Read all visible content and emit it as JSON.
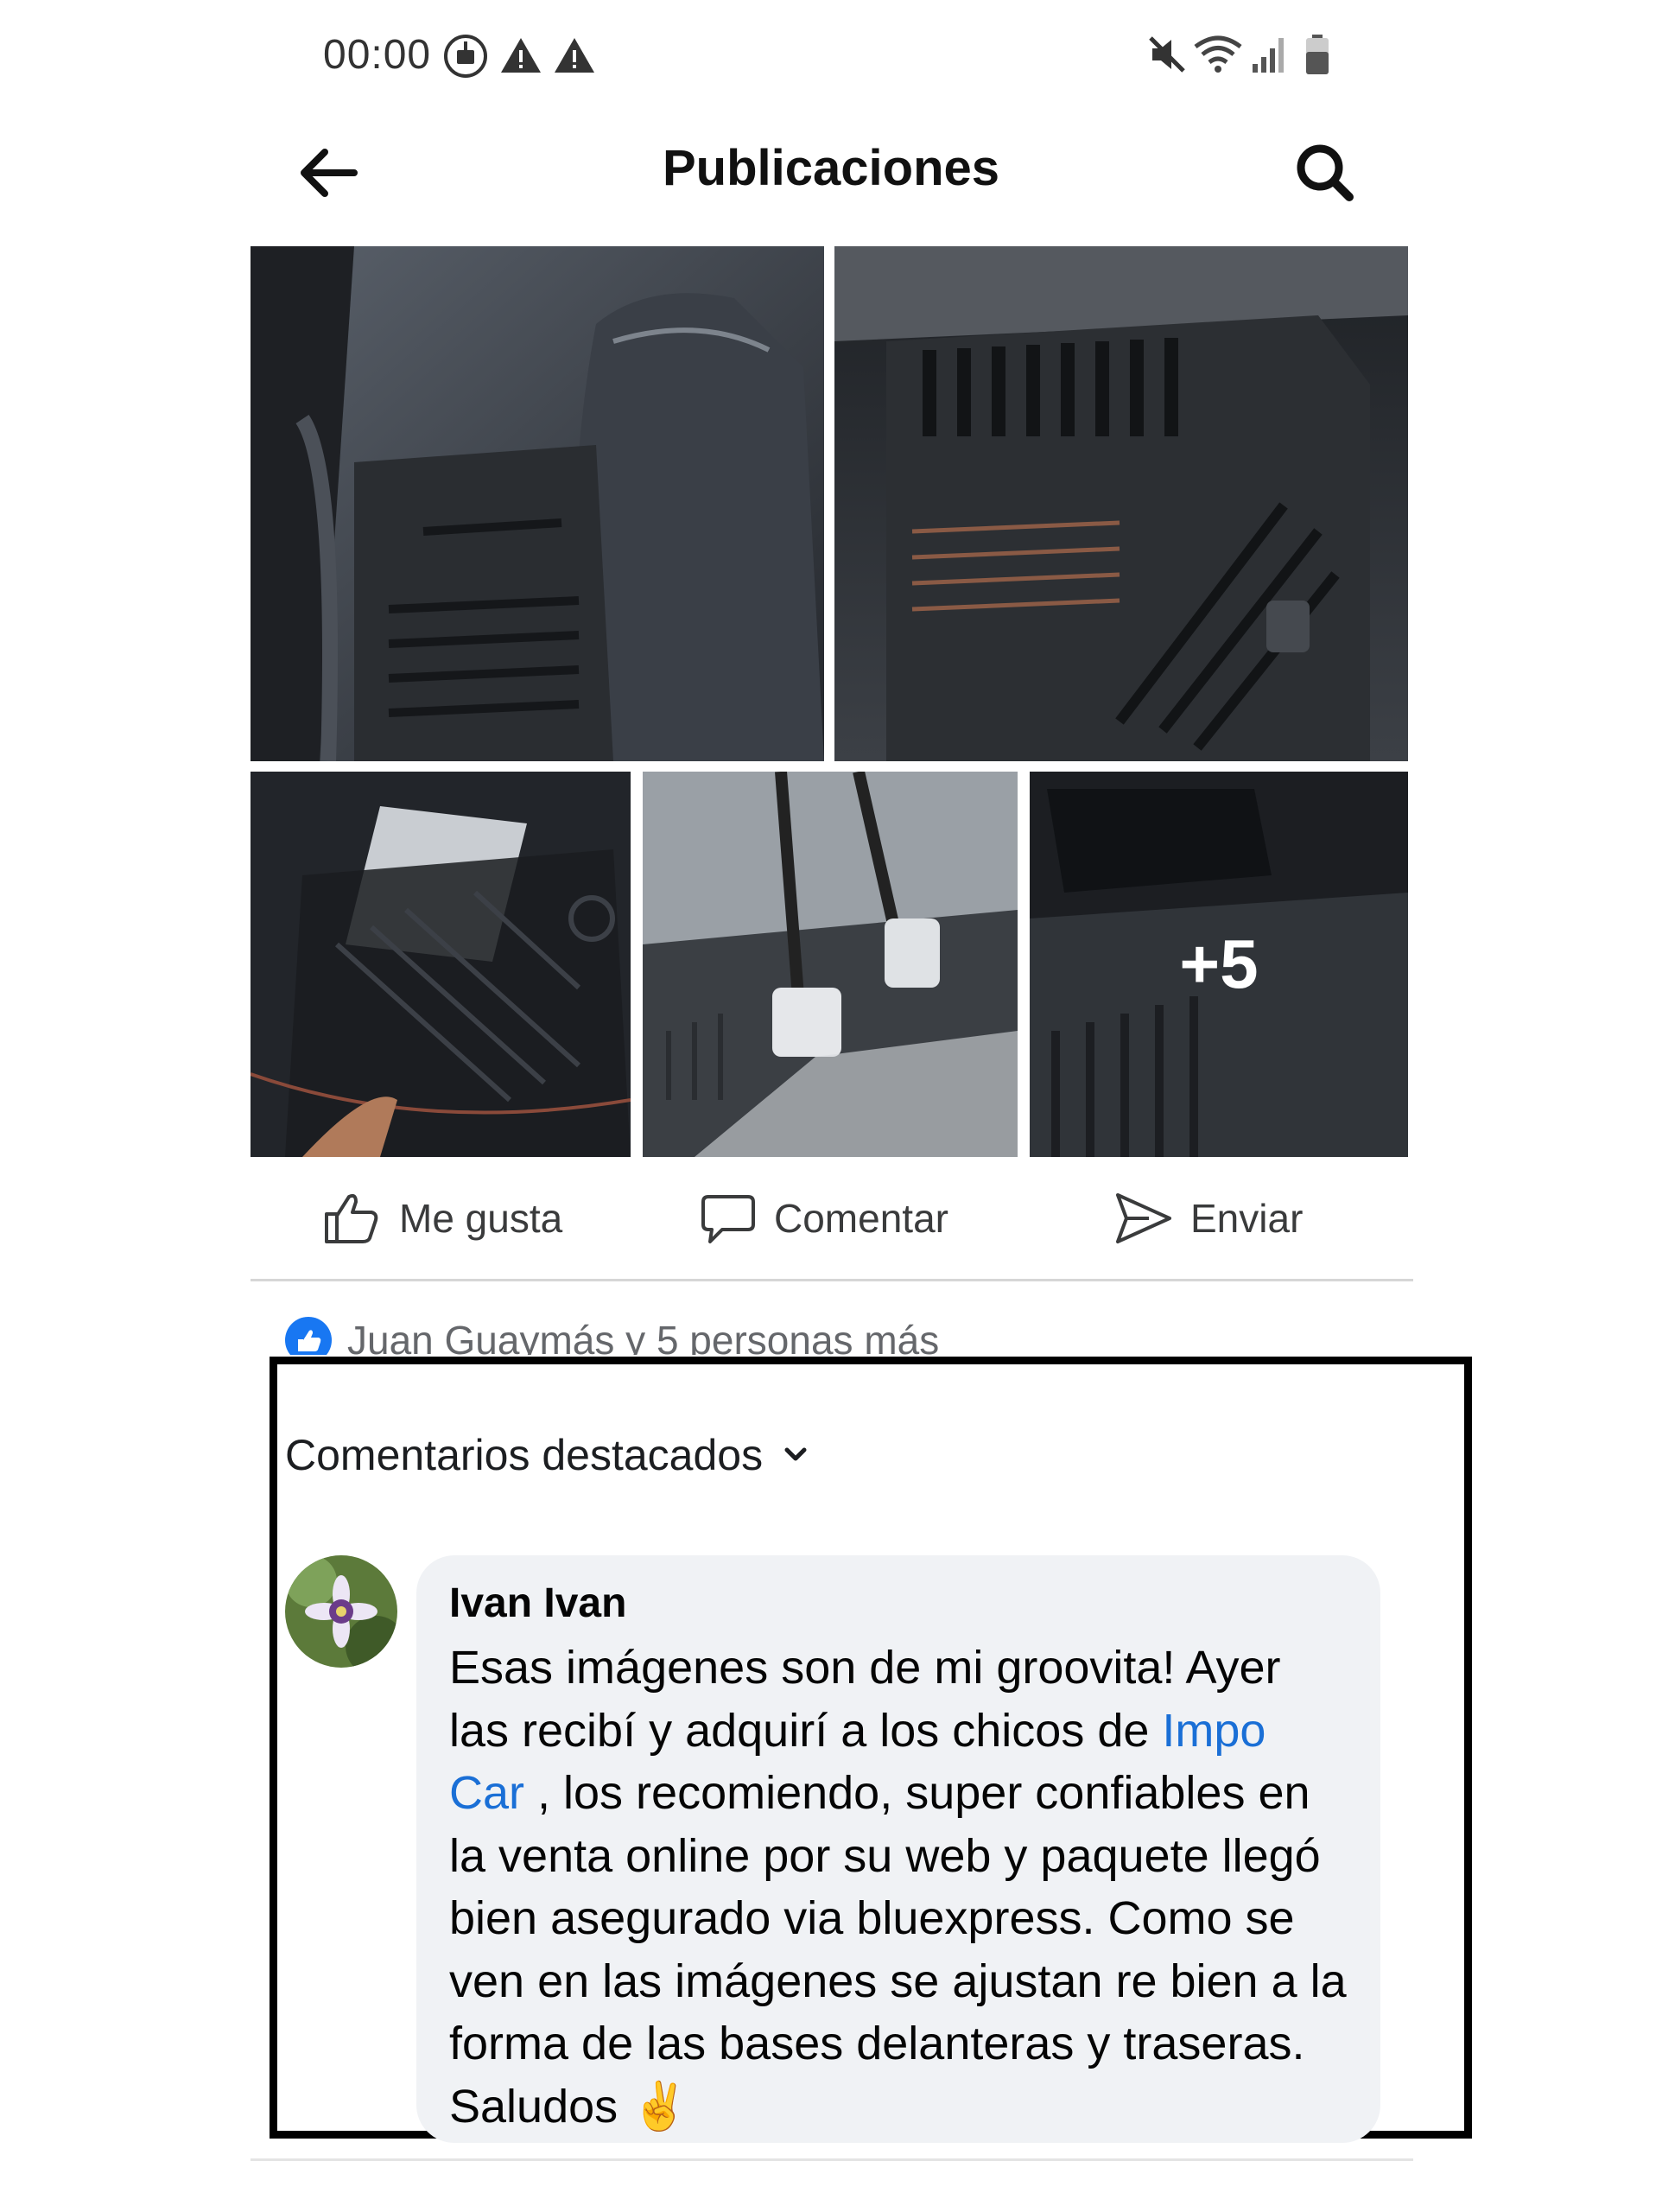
{
  "status_bar": {
    "time": "00:00",
    "left_icons": [
      "data-saver-icon",
      "warning-icon",
      "warning-icon"
    ],
    "right_icons": [
      "mute-icon",
      "wifi-icon",
      "signal-icon",
      "battery-icon"
    ]
  },
  "header": {
    "title": "Publicaciones",
    "back_icon": "arrow-left-icon",
    "search_icon": "search-icon"
  },
  "gallery": {
    "photo_count_shown": 5,
    "more_overlay": "+5"
  },
  "actions": {
    "like": "Me gusta",
    "comment": "Comentar",
    "send": "Enviar"
  },
  "reactions": {
    "text": "Juan Guaymás y 5 personas más"
  },
  "comments": {
    "sort_label": "Comentarios destacados",
    "items": [
      {
        "author": "Ivan Ivan",
        "text_before": "Esas imágenes son de mi groovita! Ayer las recibí y adquirí a los chicos de ",
        "mention": "Impo Car",
        "text_after": " , los recomiendo, super confiables en la venta online por su web y paquete llegó bien asegurado via bluexpress. Como se ven en las imágenes se ajustan re bien a la forma de las bases delanteras y traseras. Saludos ",
        "emoji": "✌"
      }
    ]
  },
  "colors": {
    "accent_blue": "#1877f2",
    "mention_blue": "#1a6fd6",
    "bubble_bg": "#f0f2f5",
    "highlight_border": "#000000"
  }
}
